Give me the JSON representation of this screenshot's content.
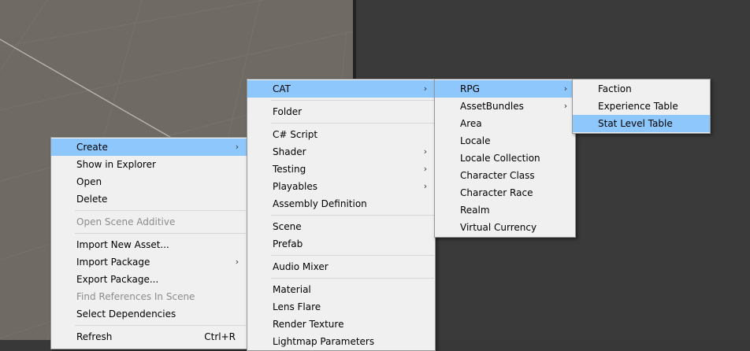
{
  "context_menu": {
    "items": [
      {
        "label": "Create"
      },
      {
        "label": "Show in Explorer"
      },
      {
        "label": "Open"
      },
      {
        "label": "Delete"
      },
      {
        "label": "Open Scene Additive"
      },
      {
        "label": "Import New Asset..."
      },
      {
        "label": "Import Package"
      },
      {
        "label": "Export Package..."
      },
      {
        "label": "Find References In Scene"
      },
      {
        "label": "Select Dependencies"
      },
      {
        "label": "Refresh",
        "shortcut": "Ctrl+R"
      }
    ]
  },
  "create_menu": {
    "items": [
      {
        "label": "CAT"
      },
      {
        "label": "Folder"
      },
      {
        "label": "C# Script"
      },
      {
        "label": "Shader"
      },
      {
        "label": "Testing"
      },
      {
        "label": "Playables"
      },
      {
        "label": "Assembly Definition"
      },
      {
        "label": "Scene"
      },
      {
        "label": "Prefab"
      },
      {
        "label": "Audio Mixer"
      },
      {
        "label": "Material"
      },
      {
        "label": "Lens Flare"
      },
      {
        "label": "Render Texture"
      },
      {
        "label": "Lightmap Parameters"
      }
    ]
  },
  "cat_menu": {
    "items": [
      {
        "label": "RPG"
      },
      {
        "label": "AssetBundles"
      },
      {
        "label": "Area"
      },
      {
        "label": "Locale"
      },
      {
        "label": "Locale Collection"
      },
      {
        "label": "Character Class"
      },
      {
        "label": "Character Race"
      },
      {
        "label": "Realm"
      },
      {
        "label": "Virtual Currency"
      }
    ]
  },
  "rpg_menu": {
    "items": [
      {
        "label": "Faction"
      },
      {
        "label": "Experience Table"
      },
      {
        "label": "Stat Level Table"
      }
    ]
  },
  "icons": {
    "submenu_arrow": "chevron-right-icon"
  },
  "colors": {
    "highlight": "#8ec7fb",
    "menu_bg": "#f0f0f0",
    "disabled_text": "#8c8c8c",
    "scene_bg": "#6f6a64"
  }
}
